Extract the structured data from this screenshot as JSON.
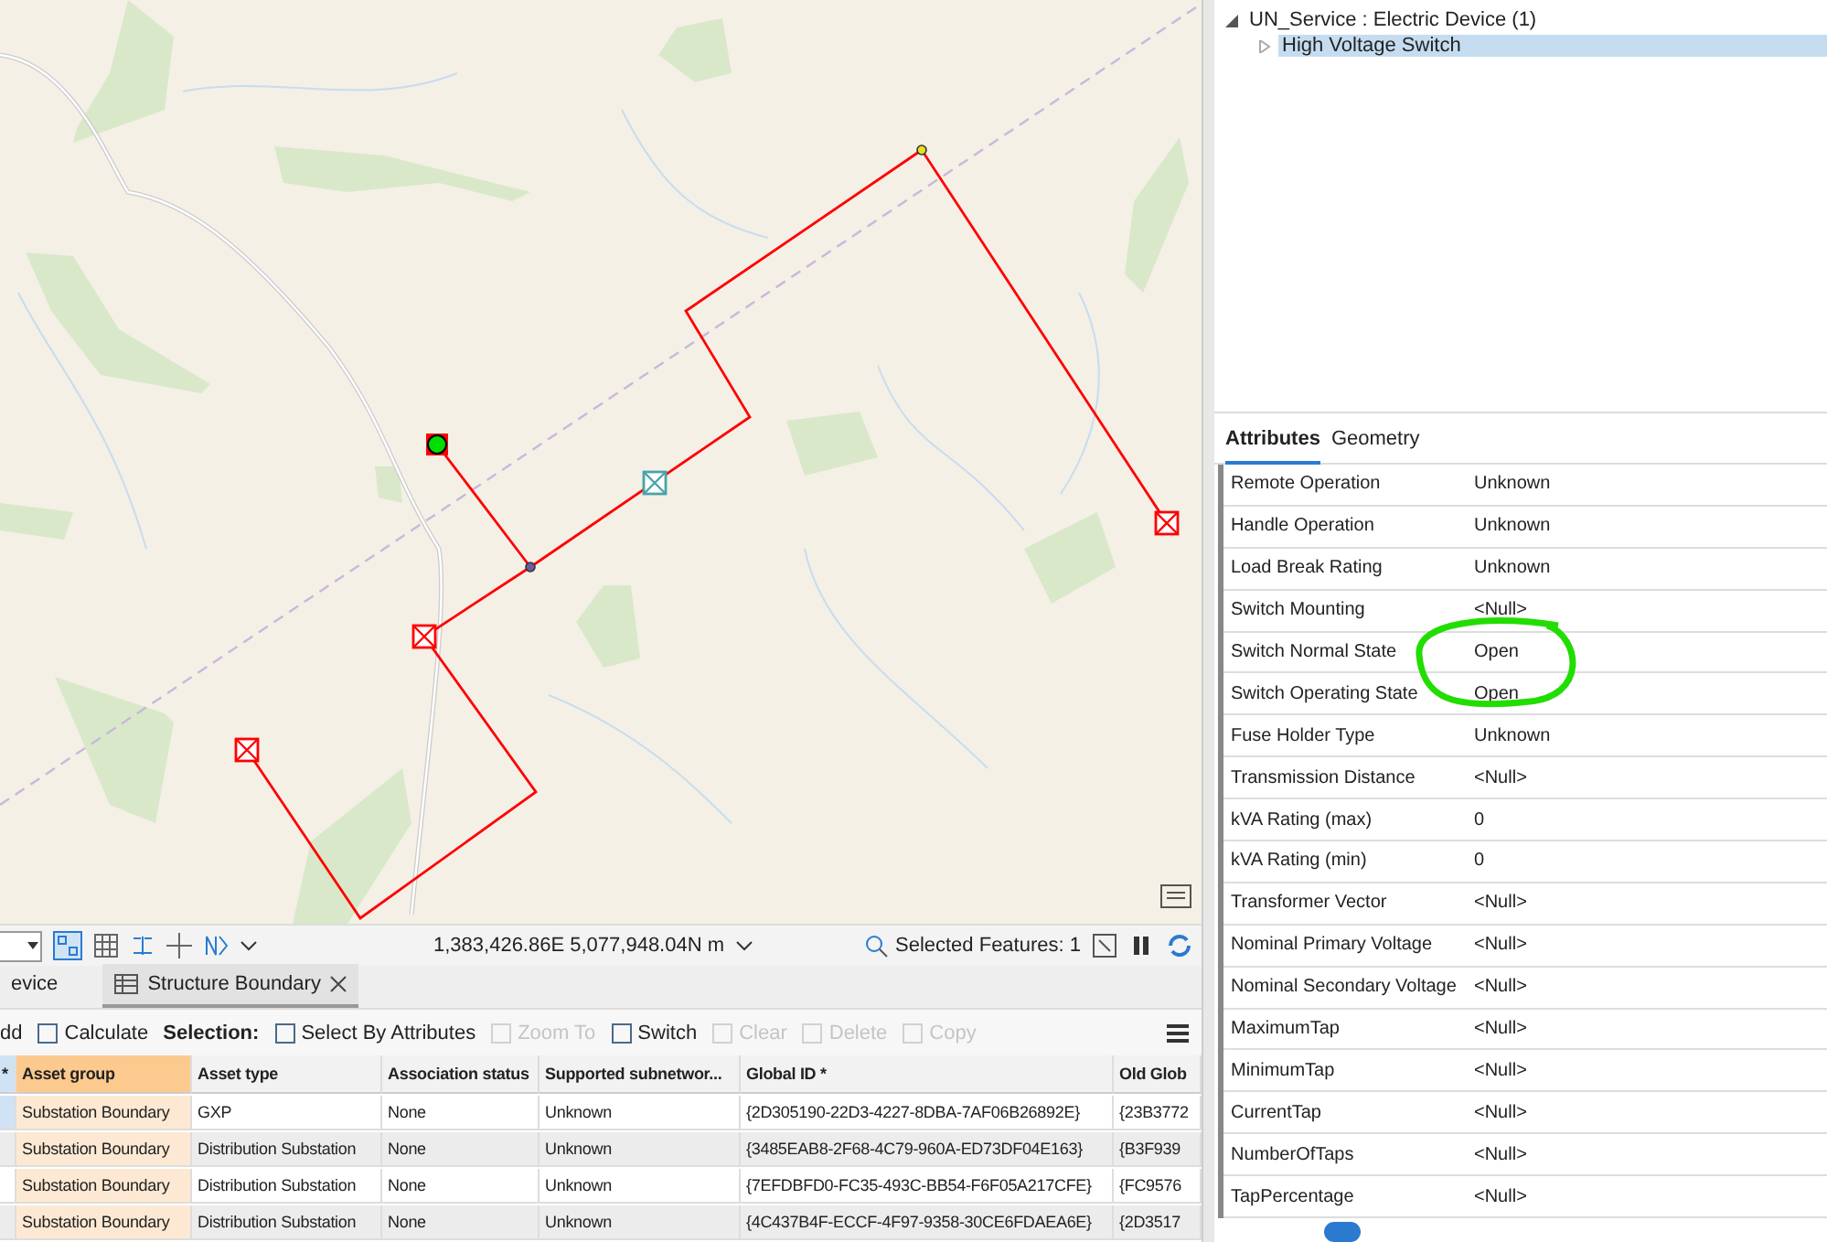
{
  "status_bar": {
    "coordinates": "1,383,426.86E 5,077,948.04N m",
    "selected_features": "Selected Features: 1"
  },
  "tabs": [
    {
      "label": "evice",
      "selected": false,
      "closable": false
    },
    {
      "label": "Structure Boundary",
      "selected": true,
      "closable": true
    }
  ],
  "toolbar": [
    {
      "kind": "button",
      "label": "dd",
      "disabled": false
    },
    {
      "kind": "button",
      "label": "Calculate",
      "disabled": false
    },
    {
      "kind": "label",
      "label": "Selection:"
    },
    {
      "kind": "button",
      "label": "Select By Attributes",
      "disabled": false
    },
    {
      "kind": "button",
      "label": "Zoom To",
      "disabled": true
    },
    {
      "kind": "button",
      "label": "Switch",
      "disabled": false
    },
    {
      "kind": "button",
      "label": "Clear",
      "disabled": true
    },
    {
      "kind": "button",
      "label": "Delete",
      "disabled": true
    },
    {
      "kind": "button",
      "label": "Copy",
      "disabled": true
    }
  ],
  "table": {
    "columns": [
      "*",
      "Asset group",
      "Asset type",
      "Association status",
      "Supported subnetwor...",
      "Global ID *",
      "Old Glob"
    ],
    "rows": [
      {
        "selected": true,
        "cells": [
          "",
          "Substation Boundary",
          "GXP",
          "None",
          "Unknown",
          "{2D305190-22D3-4227-8DBA-7AF06B26892E}",
          "{23B3772"
        ]
      },
      {
        "selected": false,
        "cells": [
          "",
          "Substation Boundary",
          "Distribution Substation",
          "None",
          "Unknown",
          "{3485EAB8-2F68-4C79-960A-ED73DF04E163}",
          "{B3F939"
        ]
      },
      {
        "selected": false,
        "cells": [
          "",
          "Substation Boundary",
          "Distribution Substation",
          "None",
          "Unknown",
          "{7EFDBFD0-FC35-493C-BB54-F6F05A217CFE}",
          "{FC9576"
        ]
      },
      {
        "selected": false,
        "cells": [
          "",
          "Substation Boundary",
          "Distribution Substation",
          "None",
          "Unknown",
          "{4C437B4F-ECCF-4F97-9358-30CE6FDAEA6E}",
          "{2D3517"
        ]
      }
    ]
  },
  "tree": [
    {
      "label": "UN_Service : Electric Device (1)",
      "expanded": true,
      "selected": false,
      "children": [
        {
          "label": "High Voltage Switch",
          "expanded": false,
          "selected": true
        }
      ]
    }
  ],
  "panel_tabs": [
    {
      "label": "Attributes",
      "selected": true
    },
    {
      "label": "Geometry",
      "selected": false
    }
  ],
  "attributes": [
    {
      "name": "Remote Operation",
      "value": "Unknown",
      "circled": false
    },
    {
      "name": "Handle Operation",
      "value": "Unknown",
      "circled": false
    },
    {
      "name": "Load Break Rating",
      "value": "Unknown",
      "circled": false
    },
    {
      "name": "Switch Mounting",
      "value": "<Null>",
      "circled": false
    },
    {
      "name": "Switch Normal State",
      "value": "Open",
      "circled": true
    },
    {
      "name": "Switch Operating State",
      "value": "Open",
      "circled": true
    },
    {
      "name": "Fuse Holder Type",
      "value": "Unknown",
      "circled": false
    },
    {
      "name": "Transmission Distance",
      "value": "<Null>",
      "circled": false
    },
    {
      "name": "kVA Rating (max)",
      "value": "0",
      "circled": false
    },
    {
      "name": "kVA Rating (min)",
      "value": "0",
      "circled": false
    },
    {
      "name": "Transformer Vector",
      "value": "<Null>",
      "circled": false
    },
    {
      "name": "Nominal Primary Voltage",
      "value": "<Null>",
      "circled": false
    },
    {
      "name": "Nominal Secondary Voltage",
      "value": "<Null>",
      "circled": false
    },
    {
      "name": "MaximumTap",
      "value": "<Null>",
      "circled": false
    },
    {
      "name": "MinimumTap",
      "value": "<Null>",
      "circled": false
    },
    {
      "name": "CurrentTap",
      "value": "<Null>",
      "circled": false
    },
    {
      "name": "NumberOfTaps",
      "value": "<Null>",
      "circled": false
    },
    {
      "name": "TapPercentage",
      "value": "<Null>",
      "circled": false
    }
  ],
  "bottom_toggle": {
    "on": true
  }
}
